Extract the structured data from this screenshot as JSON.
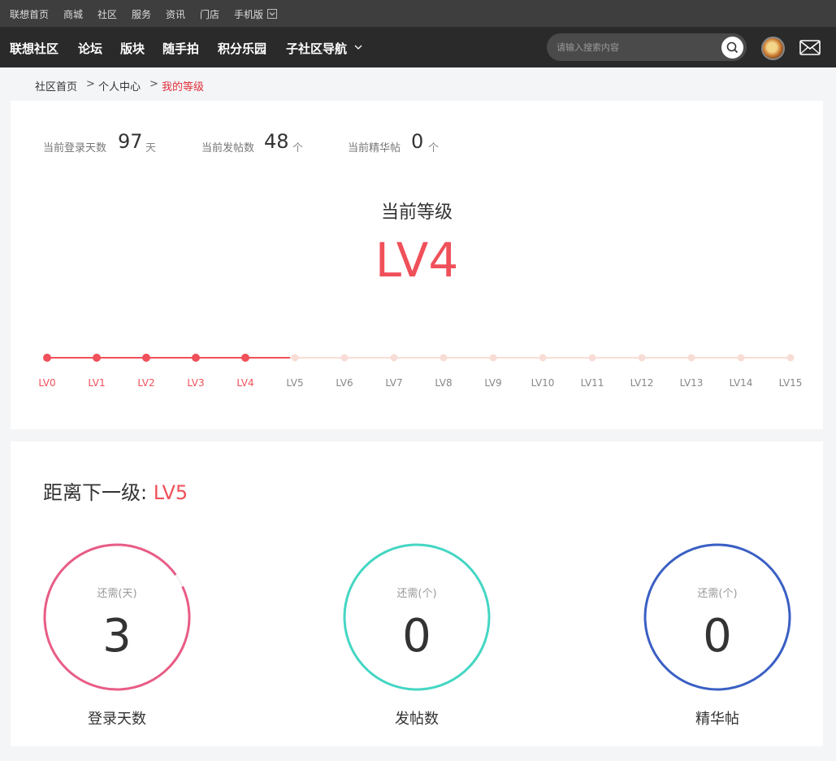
{
  "topbar": {
    "links": [
      "联想首页",
      "商城",
      "社区",
      "服务",
      "资讯",
      "门店",
      "手机版"
    ]
  },
  "nav": {
    "items": [
      "联想社区",
      "论坛",
      "版块",
      "随手拍",
      "积分乐园",
      "子社区导航"
    ],
    "search_placeholder": "请输入搜索内容"
  },
  "breadcrumb": {
    "items": [
      "社区首页",
      "个人中心",
      "我的等级"
    ],
    "separator": ">"
  },
  "stats": [
    {
      "label": "当前登录天数",
      "value": "97",
      "unit": "天"
    },
    {
      "label": "当前发帖数",
      "value": "48",
      "unit": "个"
    },
    {
      "label": "当前精华帖",
      "value": "0",
      "unit": "个"
    }
  ],
  "current": {
    "title": "当前等级",
    "level": "LV4",
    "level_index": 4
  },
  "levels": [
    "LV0",
    "LV1",
    "LV2",
    "LV3",
    "LV4",
    "LV5",
    "LV6",
    "LV7",
    "LV8",
    "LV9",
    "LV10",
    "LV11",
    "LV12",
    "LV13",
    "LV14",
    "LV15"
  ],
  "next": {
    "title": "距离下一级: ",
    "level": "LV5"
  },
  "requirements": [
    {
      "need_label": "还需(天)",
      "value": "3",
      "caption": "登录天数",
      "color": "#e85c85",
      "progress": 0.97
    },
    {
      "need_label": "还需(个)",
      "value": "0",
      "caption": "发帖数",
      "color": "#44d6c3",
      "progress": 1
    },
    {
      "need_label": "还需(个)",
      "value": "0",
      "caption": "精华帖",
      "color": "#3a5fc4",
      "progress": 1
    }
  ],
  "colors": {
    "accent": "#f0505a",
    "inactive": "#f8ddd6"
  }
}
